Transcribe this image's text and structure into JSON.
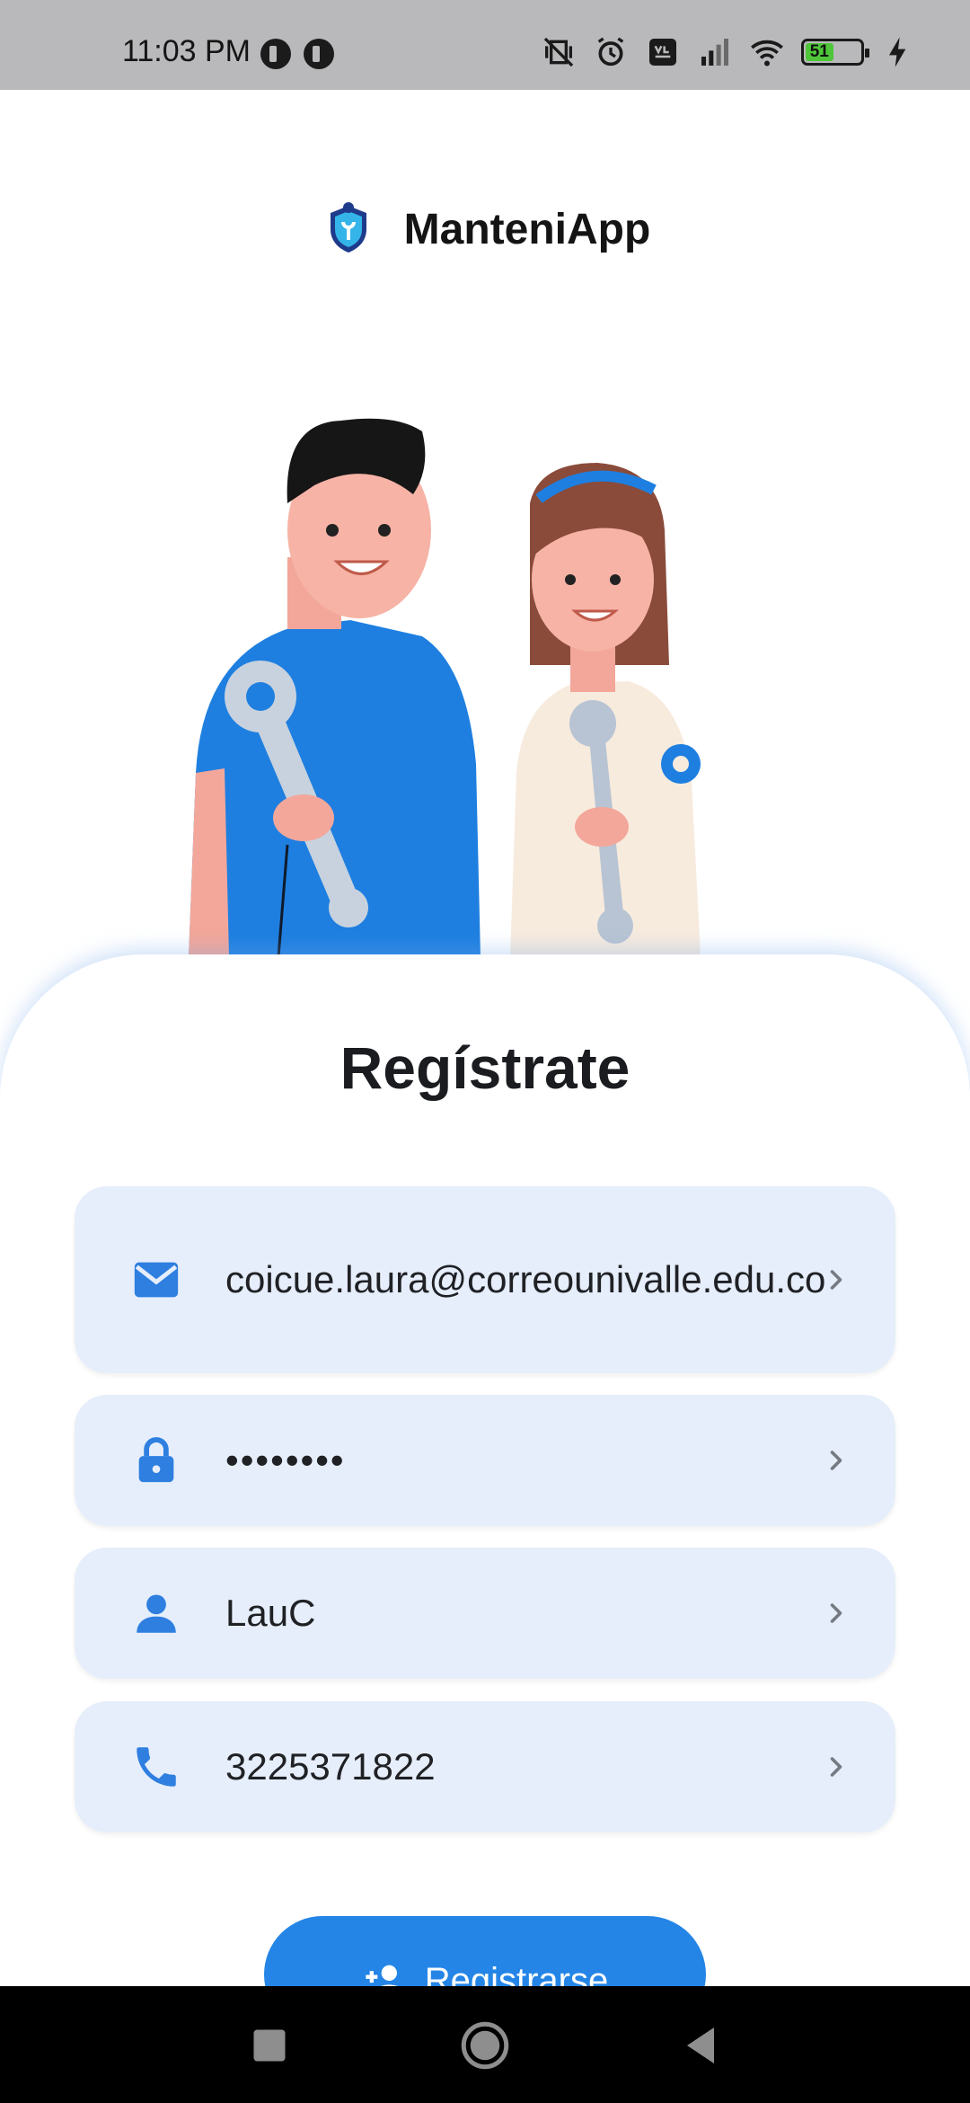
{
  "status_bar": {
    "time": "11:03 PM",
    "battery_level": "51",
    "battery_fraction": 0.51
  },
  "header": {
    "app_name": "ManteniApp",
    "logo_icon": "shield-wrench-logo"
  },
  "form": {
    "title": "Regístrate",
    "fields": [
      {
        "name": "email",
        "icon": "mail-icon",
        "value": "coicue.laura@correounivalle.edu.co"
      },
      {
        "name": "password",
        "icon": "lock-icon",
        "value": "••••••••"
      },
      {
        "name": "username",
        "icon": "person-icon",
        "value": "LauC"
      },
      {
        "name": "phone",
        "icon": "phone-icon",
        "value": "3225371822"
      }
    ],
    "submit_label": "Registrarse"
  },
  "colors": {
    "primary": "#2485e6",
    "field_bg": "#e6eefb",
    "icon_blue": "#2e7fe0",
    "status_bar_bg": "#b9b9bb"
  }
}
